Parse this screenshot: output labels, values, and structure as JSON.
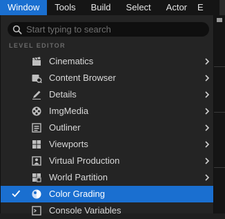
{
  "menubar": {
    "items": [
      {
        "label": "Window",
        "active": true
      },
      {
        "label": "Tools"
      },
      {
        "label": "Build"
      },
      {
        "label": "Select"
      },
      {
        "label": "Actor"
      },
      {
        "label": "E"
      }
    ]
  },
  "search": {
    "placeholder": "Start typing to search",
    "value": ""
  },
  "section_header": "LEVEL EDITOR",
  "menu_items": [
    {
      "label": "Cinematics",
      "icon": "clapperboard-icon",
      "submenu": true
    },
    {
      "label": "Content Browser",
      "icon": "content-browser-icon",
      "submenu": true
    },
    {
      "label": "Details",
      "icon": "pencil-icon",
      "submenu": true
    },
    {
      "label": "ImgMedia",
      "icon": "film-reel-icon",
      "submenu": true
    },
    {
      "label": "Outliner",
      "icon": "outliner-icon",
      "submenu": true
    },
    {
      "label": "Viewports",
      "icon": "viewports-grid-icon",
      "submenu": true
    },
    {
      "label": "Virtual Production",
      "icon": "virtual-production-icon",
      "submenu": true
    },
    {
      "label": "World Partition",
      "icon": "world-partition-icon",
      "submenu": true
    },
    {
      "label": "Color Grading",
      "icon": "color-grading-icon",
      "submenu": false,
      "checked": true,
      "selected": true
    },
    {
      "label": "Console Variables",
      "icon": "console-variables-icon",
      "submenu": false
    }
  ],
  "colors": {
    "accent": "#1a6fd0",
    "menu_bg": "#242424",
    "bar_bg": "#151515"
  }
}
